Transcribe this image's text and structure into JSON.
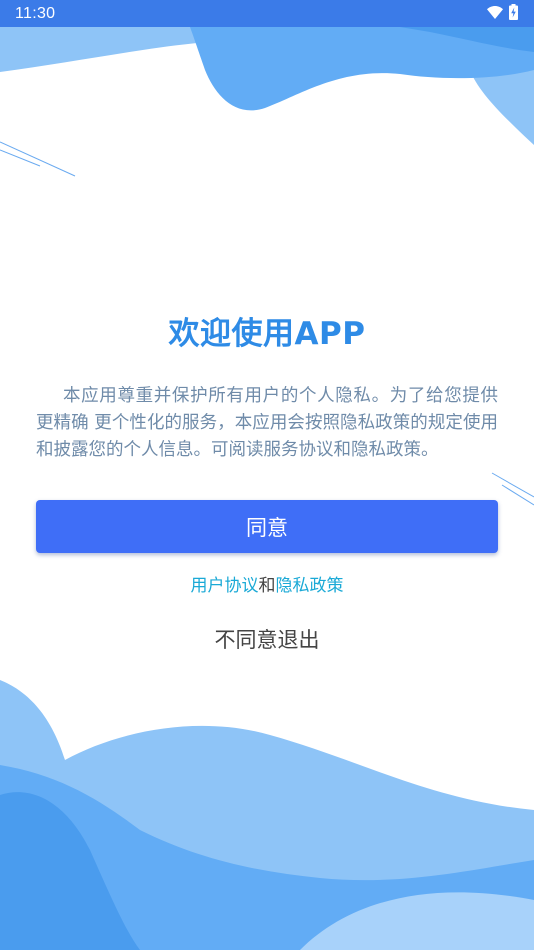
{
  "status_bar": {
    "time": "11:30",
    "icons": [
      "wifi-icon",
      "battery-charging-icon"
    ]
  },
  "colors": {
    "status_bar": "#3b7be8",
    "title": "#2e8be6",
    "body_text": "#6f8ba9",
    "button": "#3f6ef7",
    "link": "#1aa9d6",
    "wave_light": "#8ec4f7",
    "wave_mid": "#62acf5",
    "wave_dark": "#4a9cee"
  },
  "welcome": {
    "title": "欢迎使用APP",
    "intro": "本应用尊重并保护所有用户的个人隐私。为了给您提供更精确  更个性化的服务，本应用会按照隐私政策的规定使用和披露您的个人信息。可阅读服务协议和隐私政策。"
  },
  "actions": {
    "agree_label": "同意",
    "user_agreement_link": "用户协议",
    "link_joiner": "和",
    "privacy_policy_link": "隐私政策",
    "disagree_label": "不同意退出"
  }
}
